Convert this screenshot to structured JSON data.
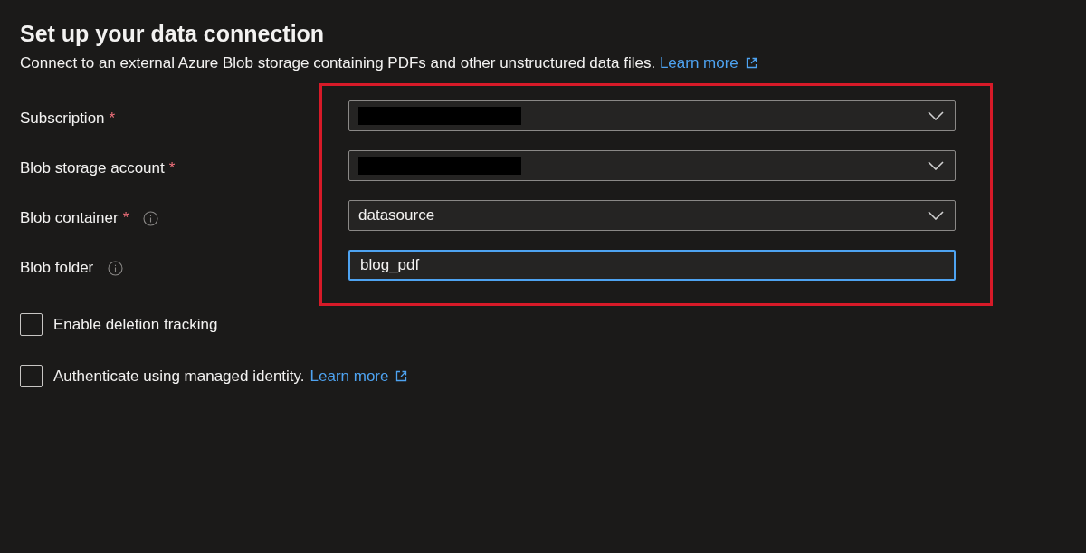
{
  "title": "Set up your data connection",
  "description": "Connect to an external Azure Blob storage containing PDFs and other unstructured data files.",
  "description_link": "Learn more",
  "fields": [
    {
      "label": "Subscription",
      "required_mark": "*",
      "info": false,
      "kind": "dropdown",
      "redacted": true,
      "focused": false
    },
    {
      "label": "Blob storage account",
      "required_mark": "*",
      "info": false,
      "kind": "dropdown",
      "redacted": true,
      "focused": false
    },
    {
      "label": "Blob container",
      "required_mark": "*",
      "info": true,
      "kind": "dropdown",
      "value": "datasource",
      "redacted": false,
      "focused": false
    },
    {
      "label": "Blob folder",
      "info": true,
      "kind": "text",
      "value": "blog_pdf",
      "redacted": false,
      "focused": true
    }
  ],
  "checkboxes": [
    {
      "label": "Enable deletion tracking",
      "checked": false
    },
    {
      "label": "Authenticate using managed identity.",
      "checked": false,
      "link": "Learn more"
    }
  ]
}
